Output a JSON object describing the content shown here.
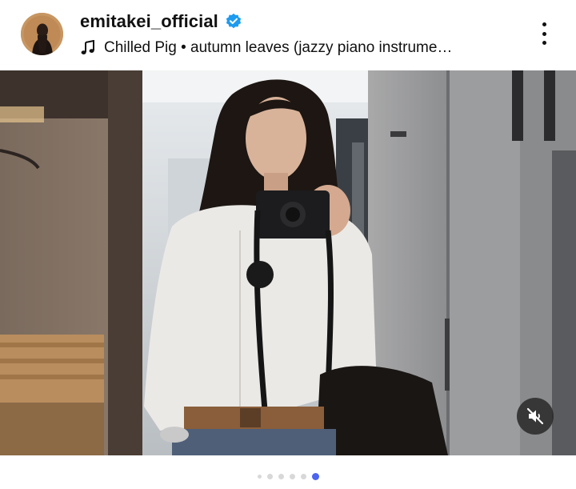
{
  "post": {
    "username": "emitakei_official",
    "verified": true,
    "music": "Chilled Pig • autumn leaves (jazzy piano instrume…"
  },
  "icons": {
    "verified": "verified-badge-icon",
    "music": "music-note-icon",
    "more": "more-options-icon",
    "mute": "speaker-muted-icon"
  },
  "carousel": {
    "total": 6,
    "active_index": 5
  },
  "colors": {
    "verified_blue": "#1d9bf0",
    "active_dot": "#4c64f0",
    "inactive_dot": "#d8d8d8"
  }
}
